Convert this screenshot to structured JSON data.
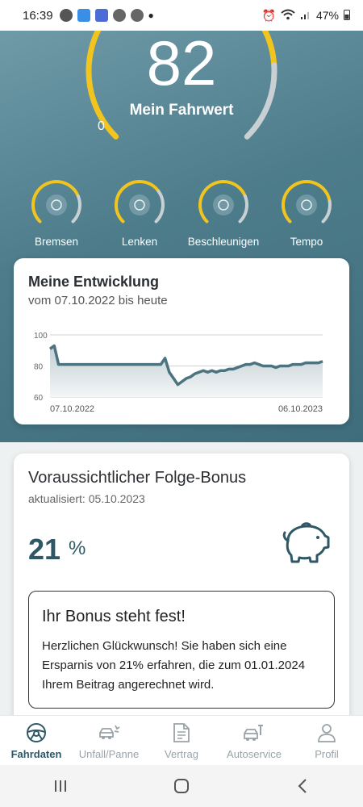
{
  "status_bar": {
    "time": "16:39",
    "battery": "47%"
  },
  "hero": {
    "score": "82",
    "score_label": "Mein Fahrwert",
    "score_min": "0",
    "sub_scores": [
      {
        "label": "Bremsen",
        "icon": "brake-icon",
        "level": 0.75
      },
      {
        "label": "Lenken",
        "icon": "steering-icon",
        "level": 0.7
      },
      {
        "label": "Beschleunigen",
        "icon": "rocket-icon",
        "level": 0.75
      },
      {
        "label": "Tempo",
        "icon": "speedometer-icon",
        "level": 0.8
      }
    ],
    "score_level": 0.82,
    "colors": {
      "accent": "#f2c41e",
      "track": "#c9d0d3"
    }
  },
  "development": {
    "title": "Meine Entwicklung",
    "subtitle": "vom 07.10.2022 bis heute"
  },
  "chart_data": {
    "type": "area",
    "title": "Meine Entwicklung",
    "y_ticks": [
      "100",
      "80",
      "60"
    ],
    "ylim": [
      60,
      100
    ],
    "x_labels": [
      "07.10.2022",
      "06.10.2023"
    ],
    "values": [
      91,
      93,
      81,
      81,
      81,
      81,
      81,
      81,
      81,
      81,
      81,
      81,
      81,
      81,
      81,
      81,
      81,
      81,
      81,
      81,
      81,
      81,
      81,
      81,
      81,
      81,
      81,
      85,
      76,
      72,
      68,
      70,
      72,
      73,
      75,
      76,
      77,
      76,
      77,
      76,
      77,
      77,
      78,
      78,
      79,
      80,
      81,
      81,
      82,
      81,
      80,
      80,
      80,
      79,
      80,
      80,
      80,
      81,
      81,
      81,
      82,
      82,
      82,
      82,
      83
    ],
    "colors": {
      "line": "#4b7380",
      "fill_top": "#c3cfd3",
      "fill_bottom": "#f3f6f7",
      "grid": "#cfd4d6"
    }
  },
  "bonus": {
    "title": "Voraussichtlicher Folge-Bonus",
    "updated": "aktualisiert: 05.10.2023",
    "value": "21",
    "unit": "%",
    "box_heading": "Ihr Bonus steht fest!",
    "box_text": "Herzlichen Glückwunsch! Sie haben sich eine Ersparnis von 21% erfahren, die zum 01.01.2024 Ihrem Beitrag angerechnet wird."
  },
  "bottom_nav": [
    {
      "label": "Fahrdaten",
      "icon": "steering-wheel-icon",
      "active": true
    },
    {
      "label": "Unfall/Panne",
      "icon": "car-crash-icon",
      "active": false
    },
    {
      "label": "Vertrag",
      "icon": "document-icon",
      "active": false
    },
    {
      "label": "Autoservice",
      "icon": "car-service-icon",
      "active": false
    },
    {
      "label": "Profil",
      "icon": "person-icon",
      "active": false
    }
  ]
}
